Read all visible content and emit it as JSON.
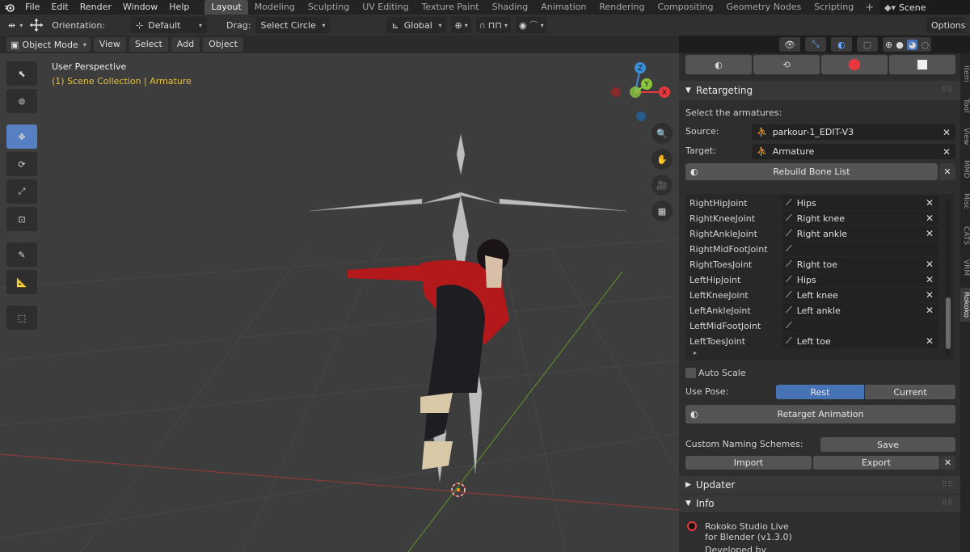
{
  "topbar": {
    "menus": [
      "File",
      "Edit",
      "Render",
      "Window",
      "Help"
    ],
    "workspaces": [
      "Layout",
      "Modeling",
      "Sculpting",
      "UV Editing",
      "Texture Paint",
      "Shading",
      "Animation",
      "Rendering",
      "Compositing",
      "Geometry Nodes",
      "Scripting"
    ],
    "active_workspace": "Layout",
    "scene_name": "Scene"
  },
  "toolheader": {
    "orientation_label": "Orientation:",
    "orientation_value": "Default",
    "drag_label": "Drag:",
    "drag_value": "Select Circle",
    "transform_value": "Global",
    "options_label": "Options"
  },
  "modeheader": {
    "mode": "Object Mode",
    "menus": [
      "View",
      "Select",
      "Add",
      "Object"
    ]
  },
  "viewport": {
    "perspective": "User Perspective",
    "collection": "(1) Scene Collection | Armature",
    "gizmo_axes": {
      "z": "Z",
      "x": "X",
      "y": "Y"
    }
  },
  "sidebar_tabs": [
    "Item",
    "Tool",
    "View",
    "MMD",
    "Misc",
    "CATS",
    "VRM",
    "Rokoko"
  ],
  "active_sidebar_tab": "Rokoko",
  "retargeting": {
    "title": "Retargeting",
    "select_label": "Select the armatures:",
    "source_label": "Source:",
    "source_value": "parkour-1_EDIT-V3",
    "target_label": "Target:",
    "target_value": "Armature",
    "rebuild_label": "Rebuild Bone List",
    "bones": [
      {
        "name": "RightHipJoint",
        "target": "Hips"
      },
      {
        "name": "RightKneeJoint",
        "target": "Right knee"
      },
      {
        "name": "RightAnkleJoint",
        "target": "Right ankle"
      },
      {
        "name": "RightMidFootJoint",
        "target": ""
      },
      {
        "name": "RightToesJoint",
        "target": "Right toe"
      },
      {
        "name": "LeftHipJoint",
        "target": "Hips"
      },
      {
        "name": "LeftKneeJoint",
        "target": "Left knee"
      },
      {
        "name": "LeftAnkleJoint",
        "target": "Left ankle"
      },
      {
        "name": "LeftMidFootJoint",
        "target": ""
      },
      {
        "name": "LeftToesJoint",
        "target": "Left toe"
      }
    ],
    "auto_scale_label": "Auto Scale",
    "auto_scale_checked": false,
    "use_pose_label": "Use Pose:",
    "pose_options": [
      "Rest",
      "Current"
    ],
    "pose_selected": "Rest",
    "retarget_label": "Retarget Animation",
    "naming_label": "Custom Naming Schemes:",
    "save_label": "Save",
    "import_label": "Import",
    "export_label": "Export"
  },
  "updater": {
    "title": "Updater"
  },
  "info": {
    "title": "Info",
    "line1": "Rokoko Studio Live",
    "line2": "for Blender (v1.3.0)",
    "line3": "Developed by"
  },
  "colors": {
    "accent": "#4772b3",
    "record": "#e8383d",
    "gizmo_x": "#e8383d",
    "gizmo_y": "#8bc53f",
    "gizmo_z": "#3b8fd8",
    "viewport_bg": "#3d3d3d",
    "collection_text": "#e4c23a"
  }
}
